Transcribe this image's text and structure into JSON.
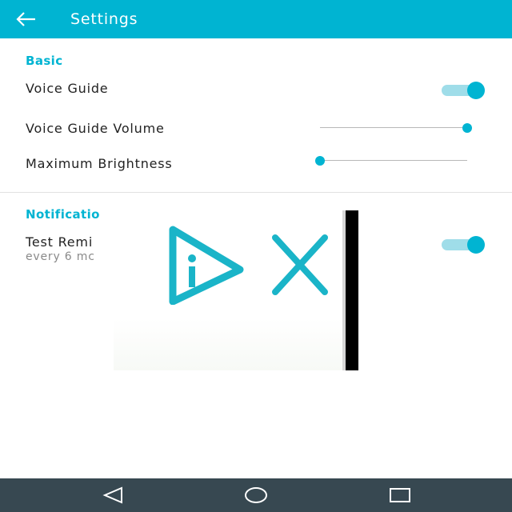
{
  "appbar": {
    "title": "Settings",
    "icon": "arrow-left-icon",
    "color": "#00b4d2"
  },
  "basic": {
    "header": "Basic",
    "voice_guide": {
      "label": "Voice Guide",
      "enabled": true
    },
    "voice_guide_volume": {
      "label": "Voice Guide Volume",
      "value_fraction": 1.0
    },
    "maximum_brightness": {
      "label": "Maximum Brightness",
      "value_fraction": 0.0
    }
  },
  "notifications": {
    "header": "Notificatio",
    "test_reminder": {
      "label": "Test Remi",
      "subtitle": "every 6 mc",
      "enabled": true
    }
  },
  "ad_overlay": {
    "icons": [
      "ad-info-icon",
      "close-icon"
    ],
    "color": "#1ab4c8"
  },
  "navbar": {
    "icons": [
      "back-triangle-icon",
      "home-circle-icon",
      "recents-square-icon"
    ],
    "color": "#374851"
  }
}
